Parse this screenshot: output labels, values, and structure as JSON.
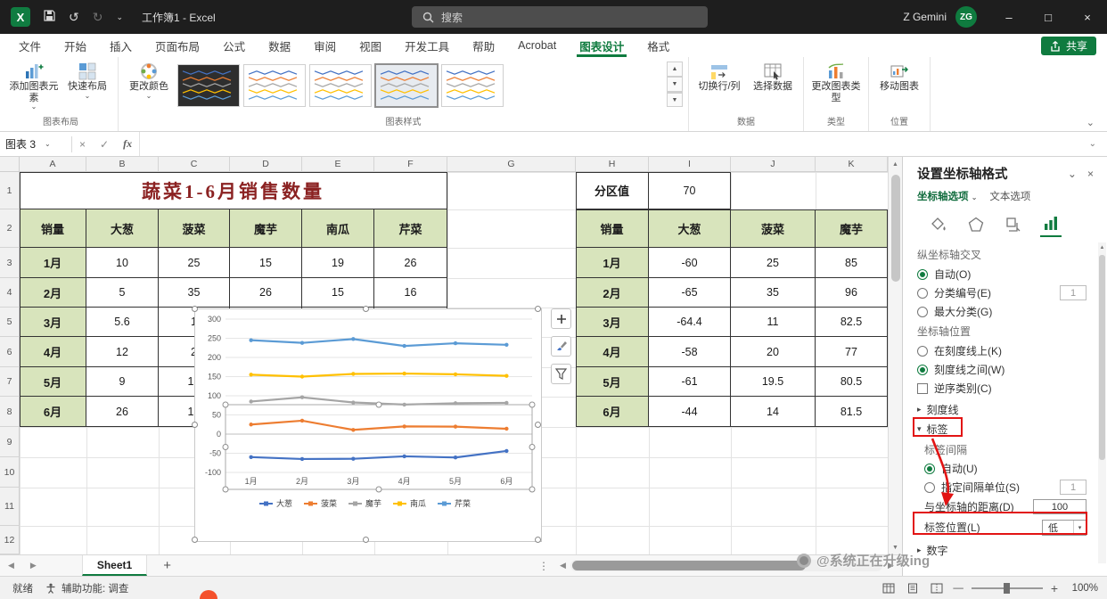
{
  "titlebar": {
    "doc_title": "工作簿1 - Excel",
    "search_placeholder": "搜索",
    "user_name": "Z Gemini",
    "user_initials": "ZG"
  },
  "ribbon": {
    "tabs": [
      "文件",
      "开始",
      "插入",
      "页面布局",
      "公式",
      "数据",
      "审阅",
      "视图",
      "开发工具",
      "帮助",
      "Acrobat",
      "图表设计",
      "格式"
    ],
    "active_tab": "图表设计",
    "share_label": "共享",
    "groups": [
      {
        "label": "图表布局",
        "buttons": [
          "添加图表元素",
          "快速布局"
        ]
      },
      {
        "label": "图表样式",
        "buttons": [
          "更改颜色"
        ]
      },
      {
        "label": "数据",
        "buttons": [
          "切换行/列",
          "选择数据"
        ]
      },
      {
        "label": "类型",
        "buttons": [
          "更改图表类型"
        ]
      },
      {
        "label": "位置",
        "buttons": [
          "移动图表"
        ]
      }
    ]
  },
  "formula_bar": {
    "name_box": "图表 3",
    "fx": "fx"
  },
  "sheet": {
    "columns": [
      "A",
      "B",
      "C",
      "D",
      "E",
      "F",
      "G",
      "H",
      "I",
      "J",
      "K"
    ],
    "row_numbers": [
      "1",
      "2",
      "3",
      "4",
      "5",
      "6",
      "7",
      "8",
      "9",
      "10",
      "11",
      "12"
    ],
    "title": "蔬菜1-6月销售数量",
    "partition_label": "分区值",
    "partition_value": "70",
    "left_table": {
      "headers": [
        "销量",
        "大葱",
        "菠菜",
        "魔芋",
        "南瓜",
        "芹菜"
      ],
      "rows": [
        {
          "month": "1月",
          "values": [
            "10",
            "25",
            "15",
            "19",
            "26"
          ]
        },
        {
          "month": "2月",
          "values": [
            "5",
            "35",
            "26",
            "15",
            "16"
          ]
        },
        {
          "month": "3月",
          "values": [
            "5.6",
            "1",
            "",
            "",
            ""
          ]
        },
        {
          "month": "4月",
          "values": [
            "12",
            "2",
            "",
            "",
            ""
          ]
        },
        {
          "month": "5月",
          "values": [
            "9",
            "19",
            "",
            "",
            ""
          ]
        },
        {
          "month": "6月",
          "values": [
            "26",
            "10",
            "",
            "",
            ""
          ]
        }
      ]
    },
    "right_table": {
      "headers": [
        "销量",
        "大葱",
        "菠菜",
        "魔芋"
      ],
      "rows": [
        {
          "month": "1月",
          "values": [
            "-60",
            "25",
            "85"
          ]
        },
        {
          "month": "2月",
          "values": [
            "-65",
            "35",
            "96"
          ]
        },
        {
          "month": "3月",
          "values": [
            "-64.4",
            "11",
            "82.5"
          ]
        },
        {
          "month": "4月",
          "values": [
            "-58",
            "20",
            "77"
          ]
        },
        {
          "month": "5月",
          "values": [
            "-61",
            "19.5",
            "80.5"
          ]
        },
        {
          "month": "6月",
          "values": [
            "-44",
            "14",
            "81.5"
          ]
        }
      ]
    }
  },
  "chart_data": {
    "type": "line",
    "categories": [
      "1月",
      "2月",
      "3月",
      "4月",
      "5月",
      "6月"
    ],
    "series": [
      {
        "name": "大葱",
        "color": "#4472C4",
        "values": [
          -60,
          -65,
          -64.4,
          -58,
          -61,
          -44
        ]
      },
      {
        "name": "菠菜",
        "color": "#ED7D31",
        "values": [
          25,
          35,
          11,
          20,
          19.5,
          14
        ]
      },
      {
        "name": "魔芋",
        "color": "#A5A5A5",
        "values": [
          85,
          96,
          82.5,
          77,
          80.5,
          81.5
        ]
      },
      {
        "name": "南瓜",
        "color": "#FFC000",
        "values": [
          155,
          150,
          157,
          158,
          156,
          152
        ]
      },
      {
        "name": "芹菜",
        "color": "#5B9BD5",
        "values": [
          245,
          238,
          248,
          230,
          237,
          233
        ]
      }
    ],
    "ylim": [
      -100,
      300
    ],
    "yticks": [
      "300",
      "250",
      "200",
      "150",
      "100",
      "50",
      "0",
      "-50",
      "-100"
    ],
    "grid": true,
    "legend_position": "bottom"
  },
  "panel": {
    "title": "设置坐标轴格式",
    "tab_axis_options": "坐标轴选项",
    "tab_text_options": "文本选项",
    "section_axis_cross": "纵坐标轴交叉",
    "opt_auto": "自动(O)",
    "opt_category_number": "分类编号(E)",
    "category_number_value": "1",
    "opt_max_category": "最大分类(G)",
    "section_axis_position": "坐标轴位置",
    "opt_on_ticks": "在刻度线上(K)",
    "opt_between_ticks": "刻度线之间(W)",
    "opt_reverse": "逆序类别(C)",
    "section_ticks": "刻度线",
    "section_labels": "标签",
    "label_interval_title": "标签间隔",
    "opt_auto_u": "自动(U)",
    "opt_interval_unit": "指定间隔单位(S)",
    "interval_unit_value": "1",
    "distance_label": "与坐标轴的距离(D)",
    "distance_value": "100",
    "label_position_label": "标签位置(L)",
    "label_position_value": "低",
    "section_number": "数字"
  },
  "sheet_tabs": {
    "active_sheet": "Sheet1",
    "add_label": "+"
  },
  "status_bar": {
    "ready": "就绪",
    "accessibility": "辅助功能: 调查",
    "zoom_level": "100%"
  },
  "watermark": {
    "text": "@系统正在升级ing"
  },
  "colors": {
    "excel_green": "#107C41",
    "table_header_fill": "#D8E4BC",
    "title_text": "#8B2222",
    "annotation_red": "#E21414"
  }
}
